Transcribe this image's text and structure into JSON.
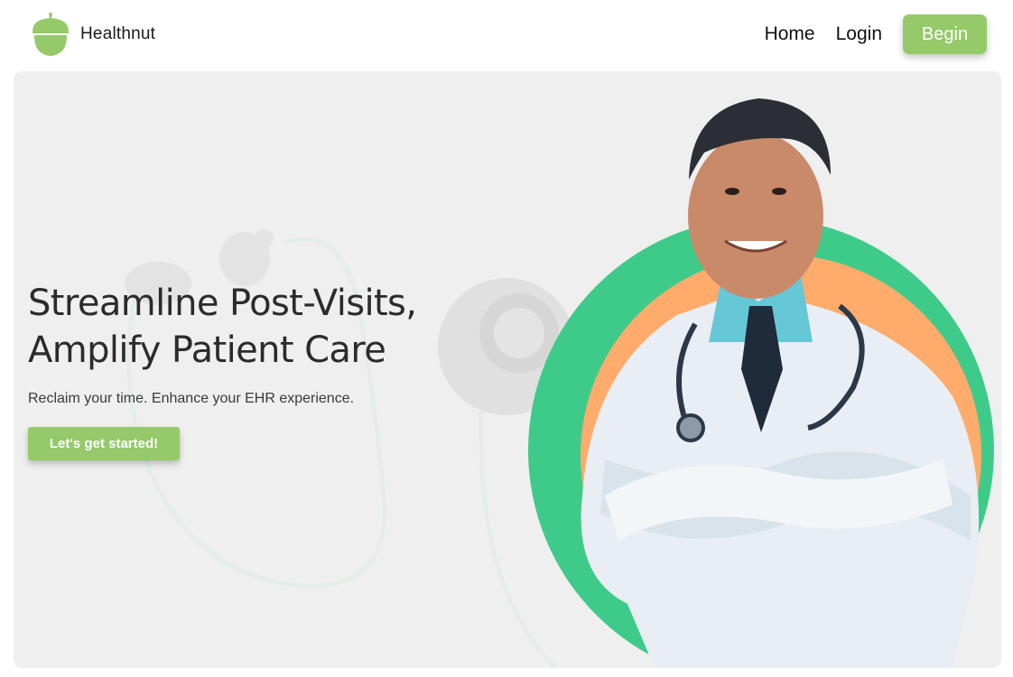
{
  "brand": {
    "name": "Healthnut",
    "logo_icon": "acorn-icon",
    "logo_color": "#95c96a"
  },
  "nav": {
    "home_label": "Home",
    "login_label": "Login",
    "begin_label": "Begin"
  },
  "hero": {
    "title_line1": "Streamline Post-Visits,",
    "title_line2": "Amplify Patient Care",
    "subtitle": "Reclaim your time. Enhance your EHR experience.",
    "cta_label": "Let's get started!",
    "image_subject": "doctor-portrait"
  },
  "colors": {
    "accent_green": "#95c96a",
    "circle_green": "#3ecb8a",
    "circle_orange": "#ffab6b",
    "hero_background": "#efefef",
    "text_dark": "#2b2b2b"
  }
}
